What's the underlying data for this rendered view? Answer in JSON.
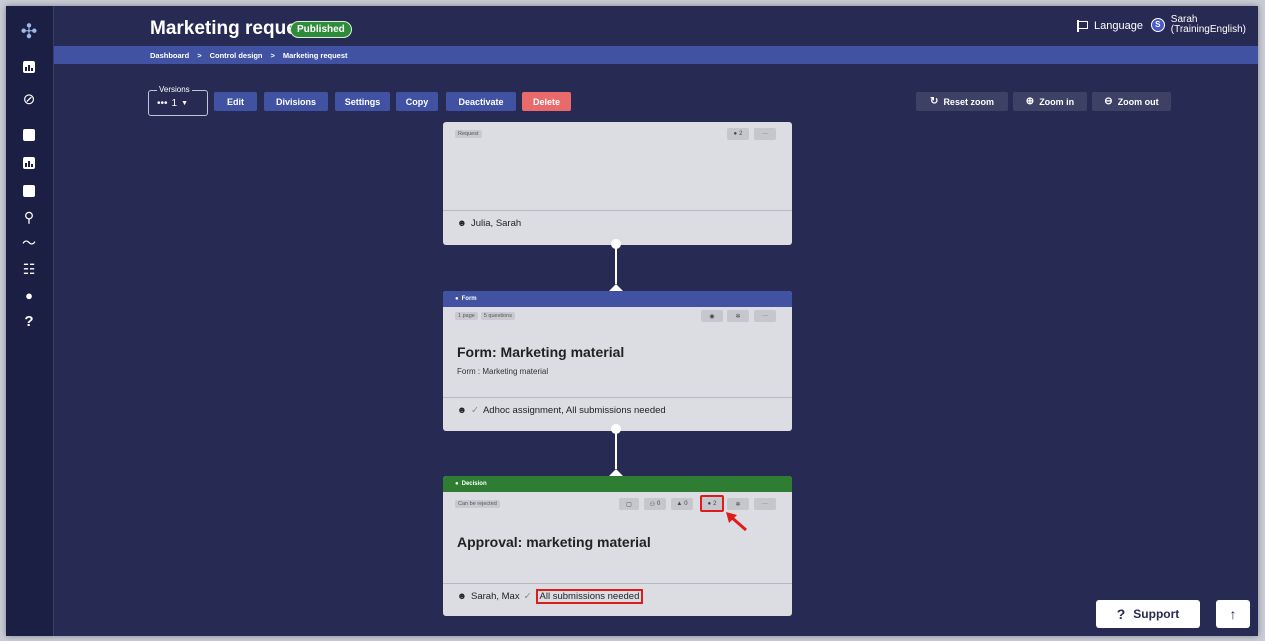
{
  "header": {
    "title": "Marketing request",
    "status_badge": "Published",
    "language_label": "Language",
    "user_initial": "S",
    "user_name_line1": "Sarah",
    "user_name_line2": "(TrainingEnglish)"
  },
  "breadcrumb": [
    "Dashboard",
    ">",
    "Control design",
    ">",
    "Marketing request"
  ],
  "toolbar": {
    "versions_label": "Versions",
    "versions_value": "1",
    "edit": "Edit",
    "divisions": "Divisions",
    "settings": "Settings",
    "copy": "Copy",
    "deactivate": "Deactivate",
    "delete": "Delete",
    "reset_zoom": "Reset zoom",
    "zoom_in": "Zoom in",
    "zoom_out": "Zoom out"
  },
  "cards": {
    "request": {
      "tag": "Request",
      "count": "2",
      "more": "···",
      "footer": "Julia, Sarah"
    },
    "form": {
      "type": "Form",
      "tag_pages": "1 page",
      "tag_questions": "5 questions",
      "more": "···",
      "title": "Form: Marketing material",
      "subtitle": "Form : Marketing material",
      "footer": "Adhoc assignment, All submissions needed"
    },
    "decision": {
      "type": "Decision",
      "tag": "Can be rejected",
      "count_a": "0",
      "count_b": "0",
      "count_c": "2",
      "more": "···",
      "title": "Approval: marketing material",
      "footer_names": "Sarah, Max",
      "footer_rule": "All submissions needed"
    }
  },
  "footer": {
    "support": "Support"
  },
  "colors": {
    "background": "#272a52",
    "accent": "#4152a3",
    "danger": "#e96a6a",
    "decision": "#2e7d32",
    "highlight": "#e01b1b"
  }
}
